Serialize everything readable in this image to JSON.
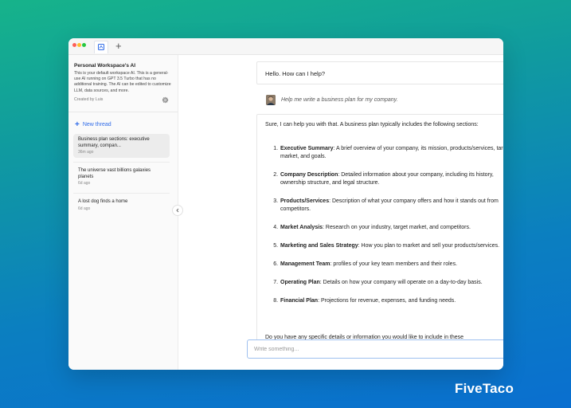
{
  "workspace": {
    "title": "Personal Workspace's AI",
    "description": "This is your default workspace AI. This is a general-use AI running on GPT 3.5 Turbo that has no additional training. The AI can be edited to customize LLM, data sources, and more.",
    "creator": "Created by Luis"
  },
  "sidebar": {
    "new_thread_label": "New thread",
    "threads": [
      {
        "title": "Business plan sections: executive summary, compan...",
        "age": "36m ago",
        "active": true
      },
      {
        "title": "The universe vast billions galaxies planets",
        "age": "6d ago",
        "active": false
      },
      {
        "title": "A lost dog finds a home",
        "age": "6d ago",
        "active": false
      }
    ]
  },
  "chat": {
    "assistant_greeting": "Hello. How can I help?",
    "user_message": "Help me write a business plan for my company.",
    "answer_intro": "Sure, I can help you with that. A business plan typically includes the following sections:",
    "answer_items": [
      {
        "heading": "Executive Summary",
        "text": ": A brief overview of your company, its mission, products/services, target market, and goals."
      },
      {
        "heading": "Company Description",
        "text": ": Detailed information about your company, including its history, ownership structure, and legal structure."
      },
      {
        "heading": "Products/Services",
        "text": ": Description of what your company offers and how it stands out from competitors."
      },
      {
        "heading": "Market Analysis",
        "text": ": Research on your industry, target market, and competitors."
      },
      {
        "heading": "Marketing and Sales Strategy",
        "text": ": How you plan to market and sell your products/services."
      },
      {
        "heading": "Management Team",
        "text": ": profiles of your key team members and their roles."
      },
      {
        "heading": "Operating Plan",
        "text": ": Details on how your company will operate on a day-to-day basis."
      },
      {
        "heading": "Financial Plan",
        "text": ": Projections for revenue, expenses, and funding needs."
      }
    ],
    "answer_outro": "Do you have any specific details or information you would like to include in these",
    "input_placeholder": "Write something..."
  },
  "brand": "FiveTaco",
  "colors": {
    "accent": "#2f6be8",
    "input_border": "#9ec0ef"
  },
  "icons": [
    "close-dot-icon",
    "minimize-dot-icon",
    "maximize-dot-icon",
    "ai-tab-icon",
    "plus-icon",
    "gear-icon",
    "chevron-left-icon"
  ]
}
